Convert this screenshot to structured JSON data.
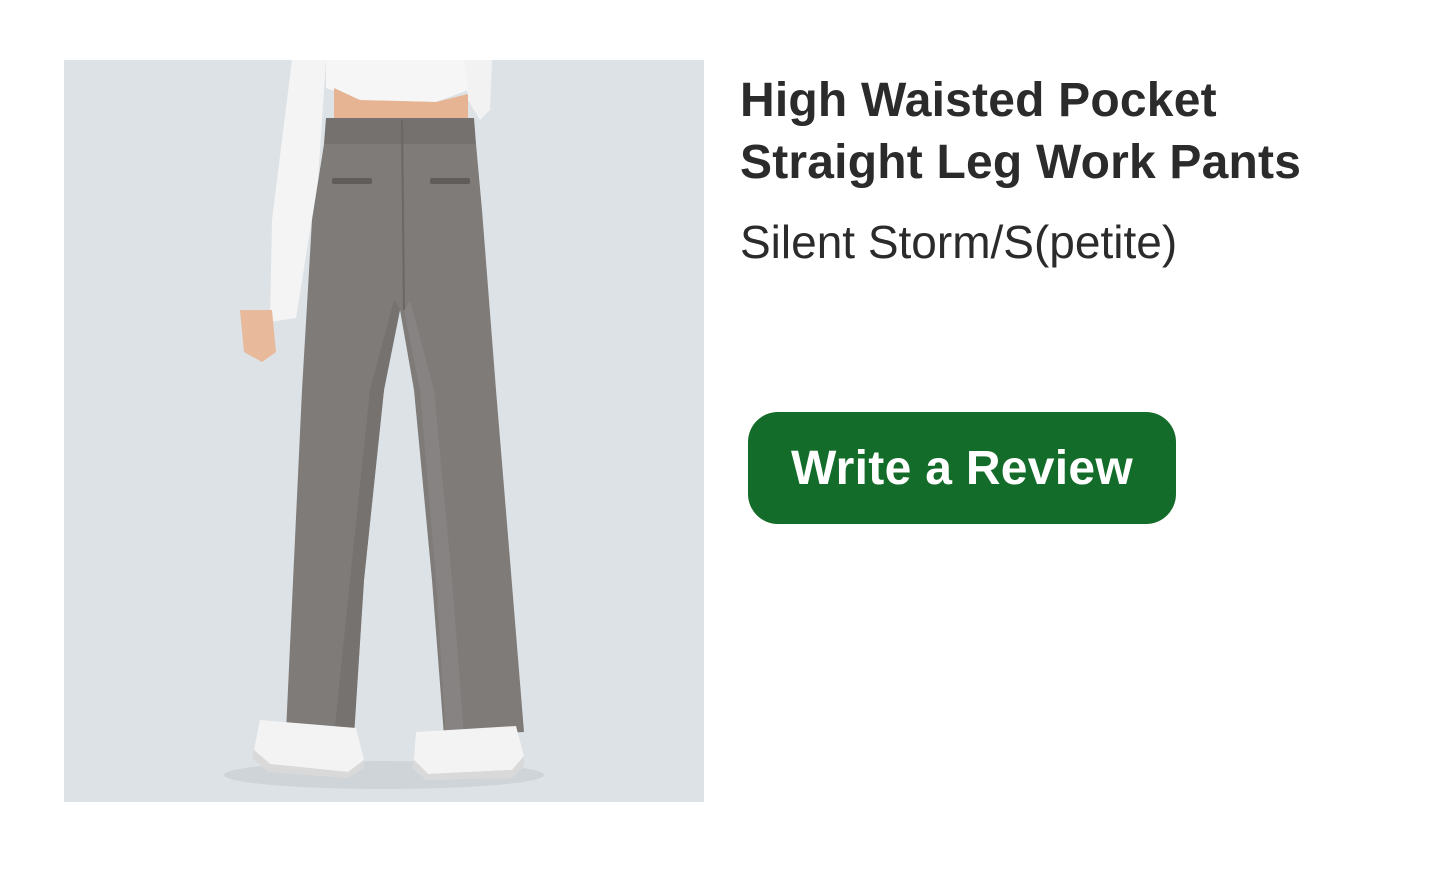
{
  "product": {
    "title_line1": "High Waisted Pocket",
    "title_line2": "Straight Leg Work Pants",
    "variant": "Silent Storm/S(petite)",
    "image_alt": "High Waisted Pocket Straight Leg Work Pants"
  },
  "actions": {
    "write_review_label": "Write a Review"
  },
  "colors": {
    "button_bg": "#146c2a",
    "button_text": "#ffffff",
    "title_text": "#2b2b2b",
    "image_bg": "#dde2e6",
    "pants": "#7e7b79"
  }
}
